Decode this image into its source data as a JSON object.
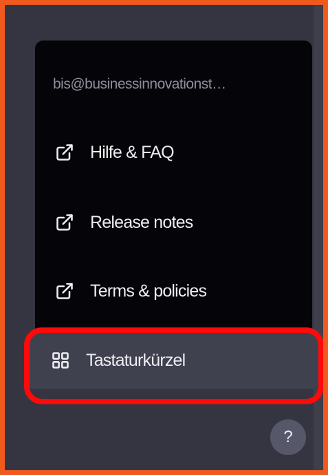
{
  "account": {
    "email": "bis@businessinnovationst…"
  },
  "menu": {
    "items": [
      {
        "label": "Hilfe & FAQ",
        "icon": "external-link-icon"
      },
      {
        "label": "Release notes",
        "icon": "external-link-icon"
      },
      {
        "label": "Terms & policies",
        "icon": "external-link-icon"
      }
    ],
    "shortcut": {
      "label": "Tastaturkürzel",
      "icon": "grid-icon"
    }
  },
  "help_button": {
    "label": "?"
  },
  "colors": {
    "panel": "#050509",
    "background": "#343541",
    "highlight": "#ff0a0a",
    "frame": "#f05a1e"
  }
}
